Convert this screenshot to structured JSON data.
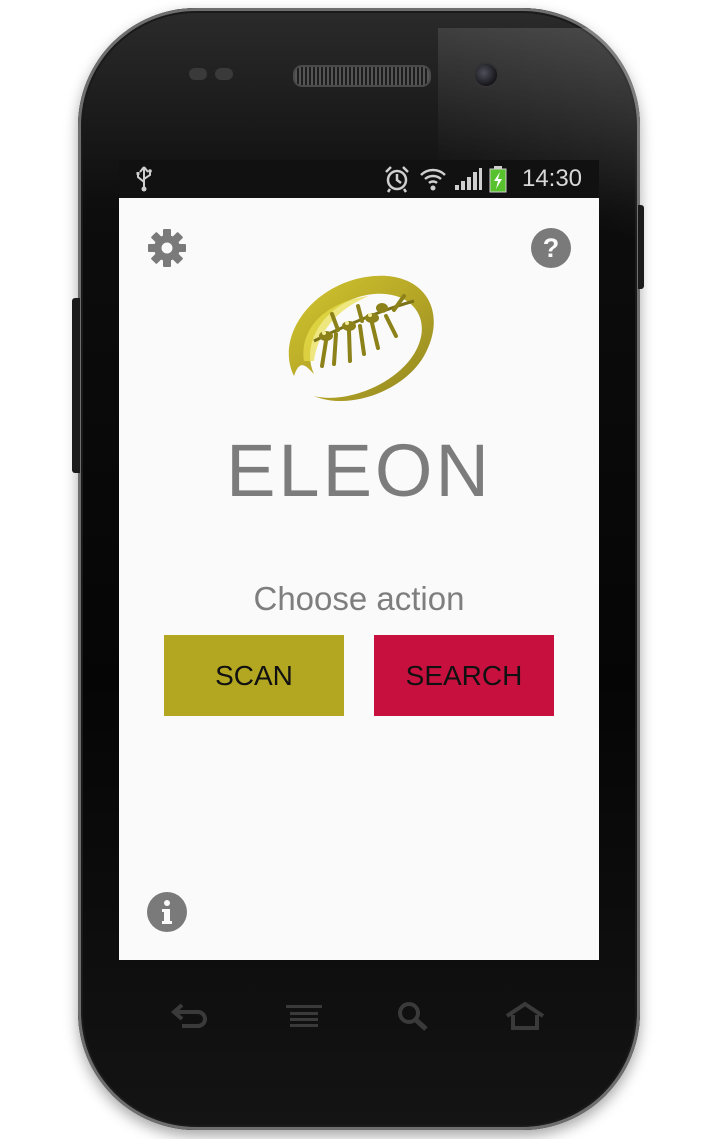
{
  "status_bar": {
    "time": "14:30",
    "icons": [
      "usb-icon",
      "alarm-icon",
      "wifi-icon",
      "signal-icon",
      "battery-charging-icon"
    ]
  },
  "app": {
    "title": "ELEON",
    "prompt": "Choose action",
    "buttons": {
      "scan": "SCAN",
      "search": "SEARCH"
    },
    "colors": {
      "scan_bg": "#b3a722",
      "search_bg": "#c8103f",
      "logo_primary": "#b7a827",
      "text_gray": "#7c7c7c"
    },
    "icons": [
      "gear-icon",
      "help-icon",
      "info-icon",
      "olive-logo"
    ]
  },
  "nav_bar": {
    "icons": [
      "back-icon",
      "menu-icon",
      "search-icon",
      "home-icon"
    ]
  }
}
